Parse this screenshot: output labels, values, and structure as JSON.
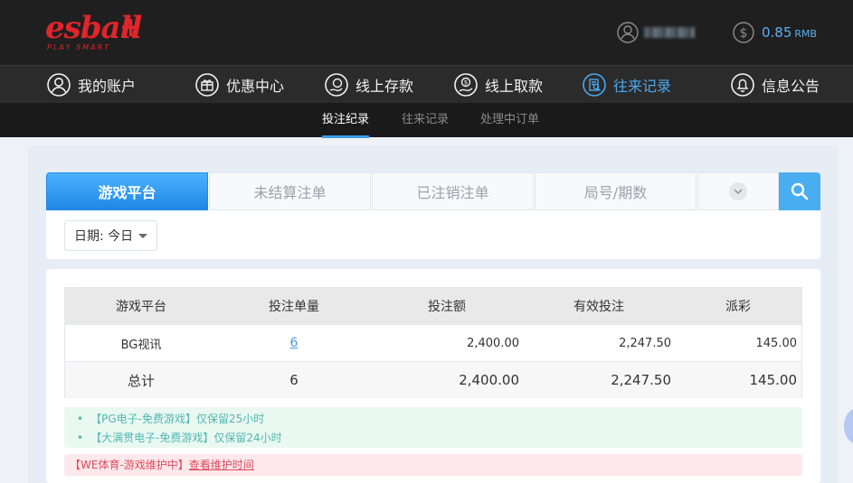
{
  "brand": {
    "logo_word": "esball",
    "logo_plus": "+",
    "logo_tagline": "PLAY SMART"
  },
  "account": {
    "balance": "0.85",
    "currency": "RMB"
  },
  "main_nav": [
    {
      "label": "我的账户",
      "icon": "user-circle-icon"
    },
    {
      "label": "优惠中心",
      "icon": "gift-icon"
    },
    {
      "label": "线上存款",
      "icon": "deposit-coin-icon"
    },
    {
      "label": "线上取款",
      "icon": "withdraw-coin-icon"
    },
    {
      "label": "往来记录",
      "icon": "record-search-icon",
      "active": true
    },
    {
      "label": "信息公告",
      "icon": "bell-icon"
    }
  ],
  "sub_nav": [
    {
      "label": "投注纪录",
      "active": true
    },
    {
      "label": "往来记录"
    },
    {
      "label": "处理中订单"
    }
  ],
  "tabs": [
    {
      "label": "游戏平台",
      "active": true
    },
    {
      "label": "未结算注单"
    },
    {
      "label": "已注销注单"
    },
    {
      "label": "局号/期数"
    }
  ],
  "filter": {
    "date_label": "日期: 今日"
  },
  "table": {
    "headers": [
      "游戏平台",
      "投注单量",
      "投注额",
      "有效投注",
      "派彩"
    ],
    "rows": [
      {
        "platform": "BG视讯",
        "count": "6",
        "bet": "2,400.00",
        "valid": "2,247.50",
        "payout": "145.00"
      }
    ],
    "total": {
      "label": "总计",
      "count": "6",
      "bet": "2,400.00",
      "valid": "2,247.50",
      "payout": "145.00"
    }
  },
  "notices": {
    "info": [
      "【PG电子-免费游戏】仅保留25小时",
      "【大满贯电子-免费游戏】仅保留24小时"
    ],
    "maintenance_text": "【WE体育-游戏维护中】",
    "maintenance_link": "查看维护时间"
  },
  "colors": {
    "accent": "#4aa8ee",
    "brand_red": "#e0252b",
    "tab_active": "#1e88e5"
  }
}
